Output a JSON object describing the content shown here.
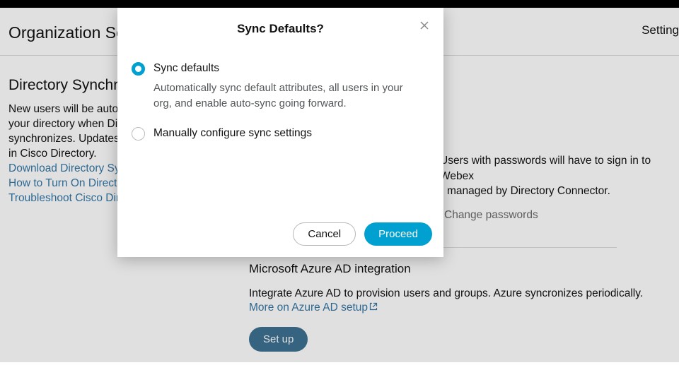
{
  "header": {
    "title": "Organization Settings",
    "right_link": "Setting"
  },
  "sidebar": {
    "heading": "Directory Synchronization",
    "paragraph": "New users will be automatically synced from your directory when Directory Connector synchronizes. Updates cannot be made directly in Cisco Directory.",
    "links": [
      "Download Directory Sync",
      "How to Turn On Directory Synchronization",
      "Troubleshoot Cisco Directory Connector"
    ]
  },
  "main": {
    "pw_line1": "Users with passwords will have to sign in to Webex",
    "pw_line2": "managed by Directory Connector.",
    "change_pw": "Change passwords",
    "azure": {
      "heading": "Microsoft Azure AD integration",
      "desc": "Integrate Azure AD to provision users and groups. Azure syncronizes periodically.",
      "more_link": "More on Azure AD setup",
      "setup_btn": "Set up"
    }
  },
  "modal": {
    "title": "Sync Defaults?",
    "options": [
      {
        "label": "Sync defaults",
        "desc": "Automatically sync default attributes, all users in your org, and enable auto-sync going forward.",
        "selected": true
      },
      {
        "label": "Manually configure sync settings",
        "desc": "",
        "selected": false
      }
    ],
    "cancel": "Cancel",
    "proceed": "Proceed"
  }
}
